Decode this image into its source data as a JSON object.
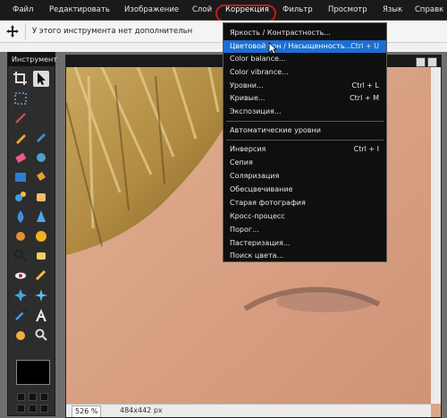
{
  "menubar": {
    "items": [
      "Файл",
      "Редактировать",
      "Изображение",
      "Слой",
      "Коррекция",
      "Фильтр",
      "Просмотр",
      "Язык",
      "Справк"
    ],
    "active_index": 4
  },
  "options_bar": {
    "text": "У этого инструмента нет дополнительн"
  },
  "tool_panel": {
    "title": "Инструмент"
  },
  "canvas": {
    "zoom": "526 %",
    "size": "484x442 px"
  },
  "dropdown": {
    "items": [
      {
        "label": "Яркость / Контрастность...",
        "shortcut": ""
      },
      {
        "label": "Цветовой тон / Насыщенность...",
        "shortcut": "Ctrl + U"
      },
      {
        "label": "Color balance...",
        "shortcut": ""
      },
      {
        "label": "Color vibrance...",
        "shortcut": ""
      },
      {
        "label": "Уровни...",
        "shortcut": "Ctrl + L"
      },
      {
        "label": "Кривые...",
        "shortcut": "Ctrl + M"
      },
      {
        "label": "Экспозиция...",
        "shortcut": ""
      },
      {
        "label": "Автоматические уровни",
        "shortcut": ""
      },
      {
        "label": "Инверсия",
        "shortcut": "Ctrl + I"
      },
      {
        "label": "Сепия",
        "shortcut": ""
      },
      {
        "label": "Соляризация",
        "shortcut": ""
      },
      {
        "label": "Обесцвечивание",
        "shortcut": ""
      },
      {
        "label": "Старая фотография",
        "shortcut": ""
      },
      {
        "label": "Кросс-процесс",
        "shortcut": ""
      },
      {
        "label": "Порог...",
        "shortcut": ""
      },
      {
        "label": "Пастеризация...",
        "shortcut": ""
      },
      {
        "label": "Поиск цвета...",
        "shortcut": ""
      }
    ],
    "highlighted_index": 1
  },
  "colors": {
    "menubar_bg": "#1a1a1a",
    "highlight": "#1b6fd3",
    "annotation_ring": "#c21a1a",
    "skin": "#d9a68a"
  }
}
